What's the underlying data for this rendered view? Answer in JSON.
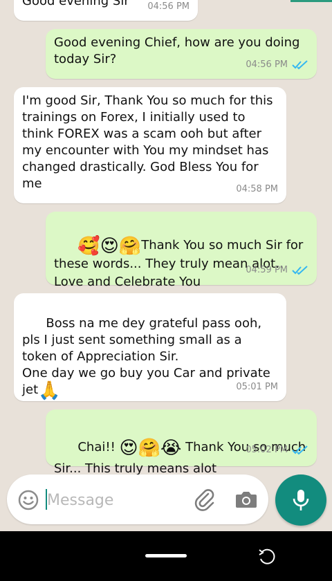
{
  "colors": {
    "incoming_bubble": "#ffffff",
    "outgoing_bubble": "#dcf8c6",
    "accent": "#128c7e",
    "read_ticks": "#34b7f1",
    "chat_background": "#e8e1d9"
  },
  "messages": [
    {
      "direction": "in",
      "text": "Good evening Sir",
      "time": "04:56 PM"
    },
    {
      "direction": "out",
      "text": "Good evening Chief, how are you doing today Sir?",
      "time": "04:56 PM",
      "status": "read"
    },
    {
      "direction": "in",
      "text": "I'm good Sir, Thank You so much for this trainings on Forex, I initially used to think FOREX was a scam ooh but after my encounter with You my mindset has changed drastically. God Bless You for me",
      "time": "04:58 PM"
    },
    {
      "direction": "out",
      "emojis": "🥰😍🤗",
      "text": "Thank You so much Sir for these words... They truly mean alot.. Love and Celebrate You",
      "time": "04:59 PM",
      "status": "read"
    },
    {
      "direction": "in",
      "text": "Boss na me dey grateful pass ooh, pls I just sent something small as a token of Appreciation Sir.\nOne day we go buy you Car and private jet",
      "emoji_after": "🙏",
      "time": "05:01 PM"
    },
    {
      "direction": "out",
      "prefix": "Chai!! ",
      "emojis": "😍🤗😭",
      "text": " Thank You so much Sir... This truly means alot",
      "time": "05:02 PM",
      "status": "read"
    }
  ],
  "composer": {
    "placeholder": "Message",
    "emoji_icon": "smiley-icon",
    "attach_icon": "paperclip-icon",
    "camera_icon": "camera-icon",
    "mic_icon": "microphone-icon"
  },
  "system_nav": {
    "home_icon": "home-pill",
    "rotate_icon": "rotate-icon"
  }
}
